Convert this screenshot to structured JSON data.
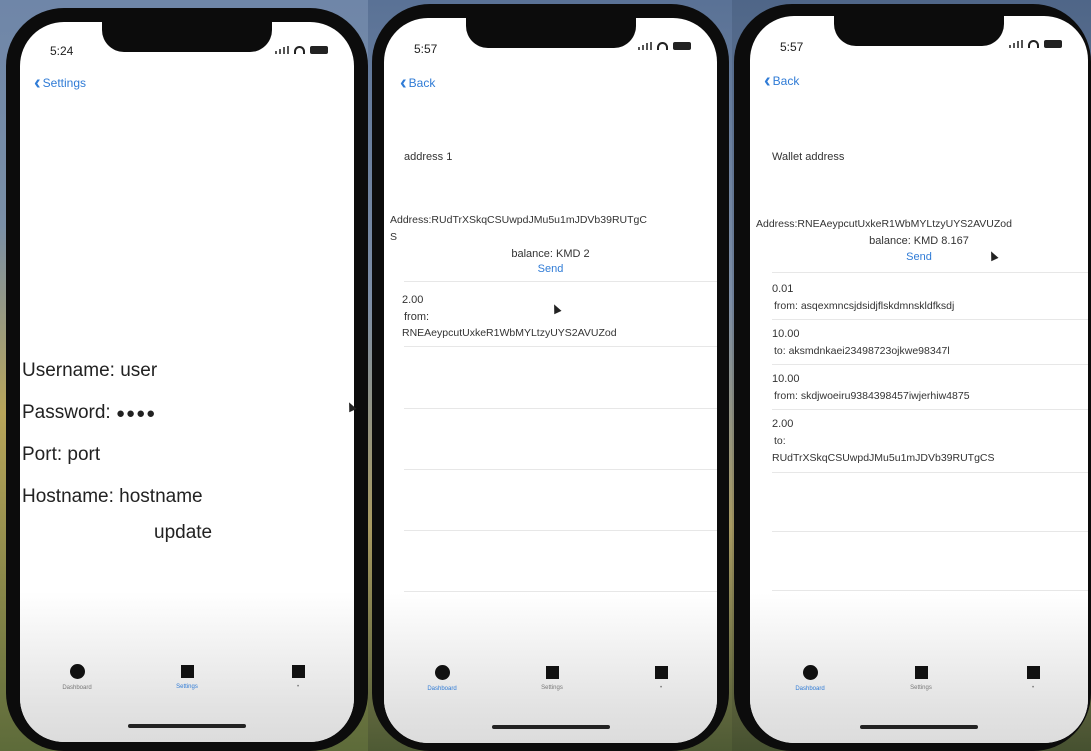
{
  "screens": [
    {
      "status_time": "5:24",
      "back_label": "Settings",
      "form": {
        "username": "Username: user",
        "password_label": "Password:",
        "password_dots": "●●●●",
        "port": "Port: port",
        "hostname": "Hostname: hostname",
        "update_label": "update"
      },
      "tabs": [
        {
          "label": "Dashboard",
          "icon": "circle-icon"
        },
        {
          "label": "Settings",
          "icon": "square-icon"
        },
        {
          "label": "•",
          "icon": "square-icon"
        }
      ],
      "active_tab": "Settings"
    },
    {
      "status_time": "5:57",
      "back_label": "Back",
      "header": "address 1",
      "address_line1": "Address:RUdTrXSkqCSUwpdJMu5u1mJDVb39RUTgC",
      "address_line2": "S",
      "balance": "balance: KMD 2",
      "send_label": "Send",
      "transactions": [
        {
          "amount": "2.00",
          "direction": "from:",
          "address": "RNEAeypcutUxkeR1WbMYLtzyUYS2AVUZod"
        }
      ],
      "tabs": [
        {
          "label": "Dashboard",
          "icon": "circle-icon"
        },
        {
          "label": "Settings",
          "icon": "square-icon"
        },
        {
          "label": "•",
          "icon": "square-icon"
        }
      ],
      "active_tab": "Dashboard"
    },
    {
      "status_time": "5:57",
      "back_label": "Back",
      "header": "Wallet address",
      "address_line1": "Address:RNEAeypcutUxkeR1WbMYLtzyUYS2AVUZod",
      "balance": "balance: KMD 8.167",
      "send_label": "Send",
      "transactions": [
        {
          "amount": "0.01",
          "line": "from: asqexmncsjdsidjflskdmnskldfksdj"
        },
        {
          "amount": "10.00",
          "line": "to: aksmdnkaei23498723ojkwe98347l"
        },
        {
          "amount": "10.00",
          "line": "from: skdjwoeiru9384398457iwjerhiw4875"
        },
        {
          "amount": "2.00",
          "line": "to:",
          "line2": "RUdTrXSkqCSUwpdJMu5u1mJDVb39RUTgCS"
        }
      ],
      "tabs": [
        {
          "label": "Dashboard",
          "icon": "circle-icon"
        },
        {
          "label": "Settings",
          "icon": "square-icon"
        },
        {
          "label": "•",
          "icon": "square-icon"
        }
      ],
      "active_tab": "Dashboard"
    }
  ],
  "colors": {
    "accent": "#2f7bd6",
    "frame": "#0c0c0c",
    "background_sky": "#6f86a8",
    "background_field": "#b8a55a"
  }
}
